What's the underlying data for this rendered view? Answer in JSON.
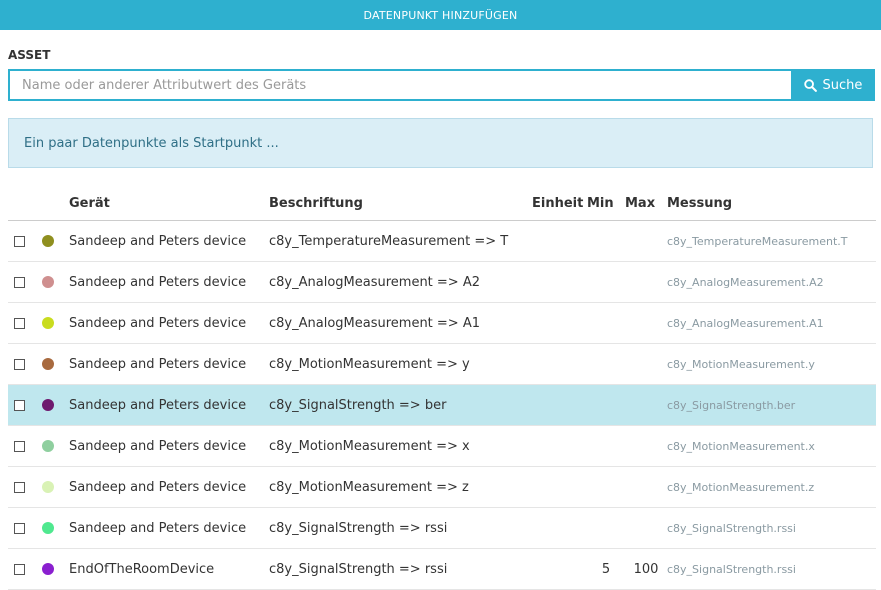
{
  "header": {
    "title": "DATENPUNKT HINZUFÜGEN"
  },
  "asset": {
    "label": "ASSET",
    "placeholder": "Name oder anderer Attributwert des Geräts",
    "search_label": "Suche"
  },
  "info": {
    "text": "Ein paar Datenpunkte als Startpunkt ..."
  },
  "table": {
    "columns": {
      "device": "Gerät",
      "label": "Beschriftung",
      "unit": "Einheit",
      "min": "Min",
      "max": "Max",
      "measurement": "Messung"
    },
    "rows": [
      {
        "color": "#8f8f1f",
        "device": "Sandeep and Peters device",
        "label": "c8y_TemperatureMeasurement => T",
        "unit": "",
        "min": "",
        "max": "",
        "measurement": "c8y_TemperatureMeasurement.T"
      },
      {
        "color": "#cf8f8f",
        "device": "Sandeep and Peters device",
        "label": "c8y_AnalogMeasurement => A2",
        "unit": "",
        "min": "",
        "max": "",
        "measurement": "c8y_AnalogMeasurement.A2"
      },
      {
        "color": "#c9dc1f",
        "device": "Sandeep and Peters device",
        "label": "c8y_AnalogMeasurement => A1",
        "unit": "",
        "min": "",
        "max": "",
        "measurement": "c8y_AnalogMeasurement.A1"
      },
      {
        "color": "#a86a3f",
        "device": "Sandeep and Peters device",
        "label": "c8y_MotionMeasurement => y",
        "unit": "",
        "min": "",
        "max": "",
        "measurement": "c8y_MotionMeasurement.y"
      },
      {
        "color": "#6e1a6e",
        "device": "Sandeep and Peters device",
        "label": "c8y_SignalStrength => ber",
        "unit": "",
        "min": "",
        "max": "",
        "measurement": "c8y_SignalStrength.ber",
        "highlight": true
      },
      {
        "color": "#8fcf9f",
        "device": "Sandeep and Peters device",
        "label": "c8y_MotionMeasurement => x",
        "unit": "",
        "min": "",
        "max": "",
        "measurement": "c8y_MotionMeasurement.x"
      },
      {
        "color": "#d9f2b5",
        "device": "Sandeep and Peters device",
        "label": "c8y_MotionMeasurement => z",
        "unit": "",
        "min": "",
        "max": "",
        "measurement": "c8y_MotionMeasurement.z"
      },
      {
        "color": "#4fe88f",
        "device": "Sandeep and Peters device",
        "label": "c8y_SignalStrength => rssi",
        "unit": "",
        "min": "",
        "max": "",
        "measurement": "c8y_SignalStrength.rssi"
      },
      {
        "color": "#8a1fcf",
        "device": "EndOfTheRoomDevice",
        "label": "c8y_SignalStrength => rssi",
        "unit": "",
        "min": "5",
        "max": "100",
        "measurement": "c8y_SignalStrength.rssi"
      }
    ]
  }
}
